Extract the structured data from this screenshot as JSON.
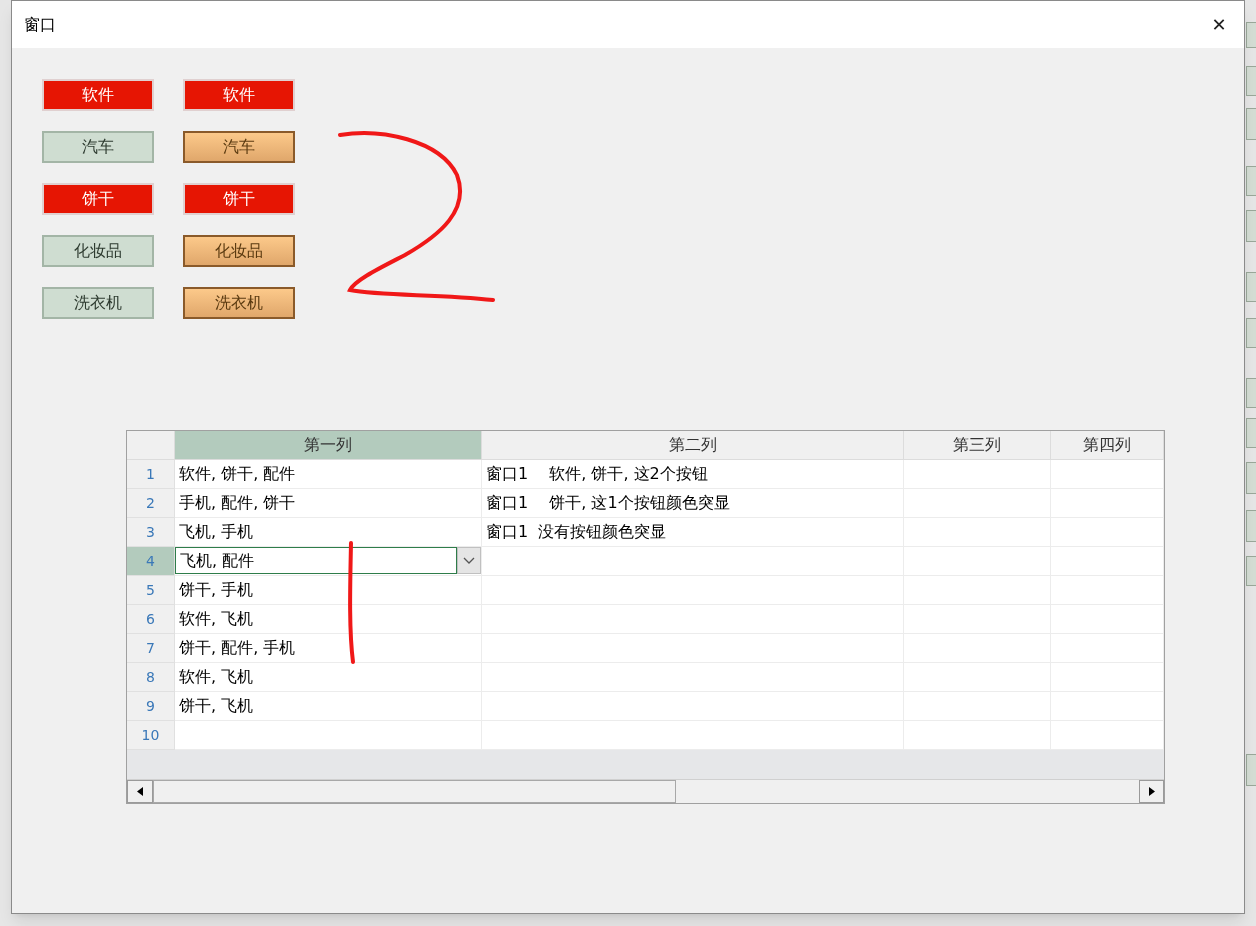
{
  "window": {
    "title": "窗口",
    "close": "✕"
  },
  "button_columns": [
    {
      "kind": "plain",
      "buttons": [
        {
          "label": "软件",
          "highlighted": true
        },
        {
          "label": "汽车",
          "highlighted": false
        },
        {
          "label": "饼干",
          "highlighted": true
        },
        {
          "label": "化妆品",
          "highlighted": false
        },
        {
          "label": "洗衣机",
          "highlighted": false
        }
      ]
    },
    {
      "kind": "orange",
      "buttons": [
        {
          "label": "软件",
          "highlighted": true
        },
        {
          "label": "汽车",
          "highlighted": false
        },
        {
          "label": "饼干",
          "highlighted": true
        },
        {
          "label": "化妆品",
          "highlighted": false
        },
        {
          "label": "洗衣机",
          "highlighted": false
        }
      ]
    }
  ],
  "table": {
    "columns": [
      {
        "label": "第一列",
        "selected": true
      },
      {
        "label": "第二列",
        "selected": false
      },
      {
        "label": "第三列",
        "selected": false
      },
      {
        "label": "第四列",
        "selected": false
      }
    ],
    "rows": [
      {
        "number": "1",
        "selected": false,
        "cells": [
          "软件, 饼干, 配件",
          "窗口1　 软件, 饼干, 这2个按钮"
        ]
      },
      {
        "number": "2",
        "selected": false,
        "cells": [
          "手机, 配件, 饼干",
          "窗口1　 饼干, 这1个按钮颜色突显"
        ]
      },
      {
        "number": "3",
        "selected": false,
        "cells": [
          "飞机, 手机",
          "窗口1  没有按钮颜色突显"
        ]
      },
      {
        "number": "4",
        "selected": true,
        "cells": [
          "飞机, 配件"
        ]
      },
      {
        "number": "5",
        "selected": false,
        "cells": [
          "饼干, 手机"
        ]
      },
      {
        "number": "6",
        "selected": false,
        "cells": [
          "软件, 飞机"
        ]
      },
      {
        "number": "7",
        "selected": false,
        "cells": [
          "饼干, 配件, 手机"
        ]
      },
      {
        "number": "8",
        "selected": false,
        "cells": [
          "软件, 飞机"
        ]
      },
      {
        "number": "9",
        "selected": false,
        "cells": [
          "饼干, 飞机"
        ]
      },
      {
        "number": "10",
        "selected": false,
        "cells": []
      }
    ]
  }
}
